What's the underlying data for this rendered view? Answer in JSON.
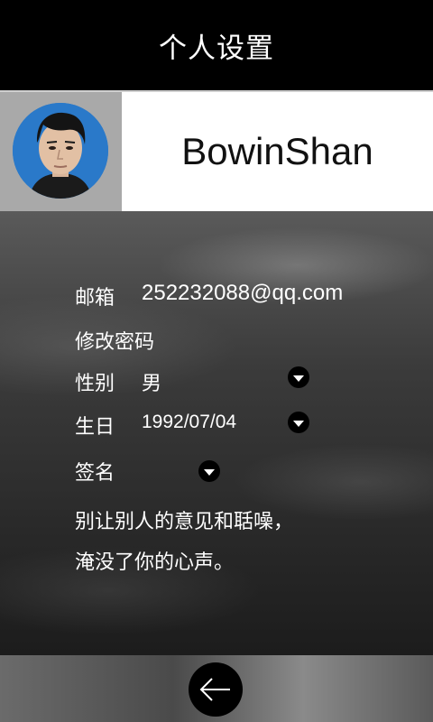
{
  "header": {
    "title": "个人设置"
  },
  "profile": {
    "username": "BowinShan"
  },
  "settings": {
    "email_label": "邮箱",
    "email_value": "252232088@qq.com",
    "change_password_label": "修改密码",
    "gender_label": "性别",
    "gender_value": "男",
    "birthday_label": "生日",
    "birthday_value": "1992/07/04",
    "signature_label": "签名",
    "signature_lines": [
      "别让别人的意见和聒噪，",
      "淹没了你的心声。"
    ]
  },
  "icons": {
    "dropdown": "chevron-down-icon",
    "back": "back-arrow-icon"
  },
  "colors": {
    "title_bar": "#000000",
    "avatar_ring": "#2a79c9"
  }
}
